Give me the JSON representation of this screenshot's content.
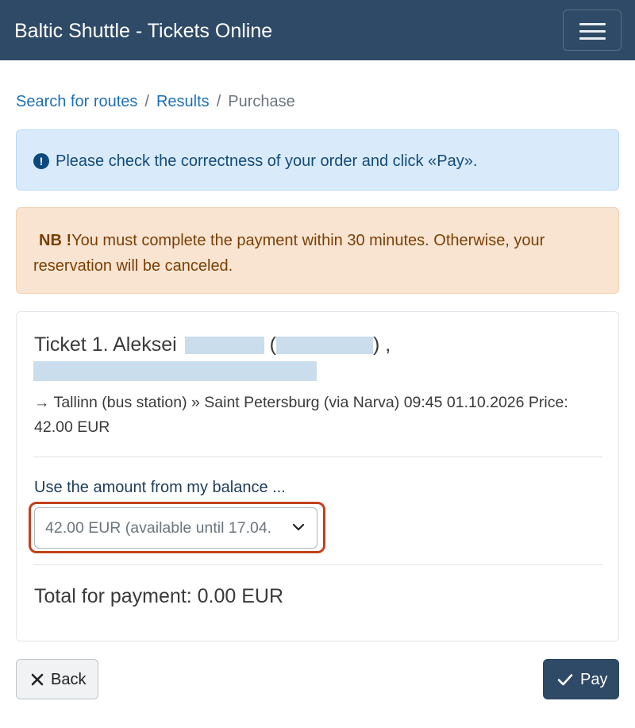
{
  "navbar": {
    "brand": "Baltic Shuttle - Tickets Online",
    "menu_icon": "hamburger-menu-icon"
  },
  "breadcrumb": {
    "items": [
      "Search for routes",
      "Results"
    ],
    "separator": "/",
    "active": "Purchase"
  },
  "info_alert": {
    "icon": "exclamation-circle-icon",
    "text": "Please check the correctness of your order and click «Pay»."
  },
  "warning_alert": {
    "nb": "NB !",
    "text": "You must complete the payment within 30 minutes. Otherwise, your reservation will be canceled."
  },
  "ticket": {
    "title_prefix": "Ticket 1. Aleksei",
    "paren_open": "(",
    "paren_close": ") ,",
    "route_arrow": "→",
    "route": "Tallinn (bus station) » Saint Petersburg (via Narva) 09:45 01.10.2026 Price: 42.00 EUR"
  },
  "balance": {
    "label": "Use the amount from my balance ...",
    "selected": "42.00 EUR (available until 17.04.",
    "chevron_icon": "chevron-down-icon"
  },
  "total": {
    "text": "Total for payment: 0.00 EUR"
  },
  "buttons": {
    "back_label": "Back",
    "back_icon": "close-icon",
    "pay_label": "Pay",
    "pay_icon": "checkmark-icon"
  },
  "colors": {
    "navbar": "#2f4a66",
    "link": "#1f6fb5",
    "info_bg": "#d9ebfb",
    "warning_bg": "#f8e4d0",
    "highlight": "#c0421c"
  }
}
